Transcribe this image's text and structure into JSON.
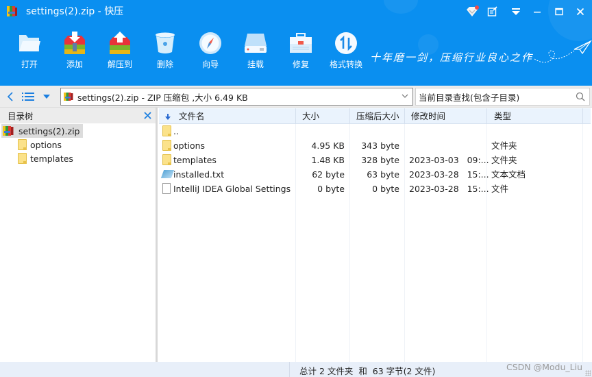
{
  "window": {
    "title": "settings(2).zip - 快压",
    "controls": [
      "vip-diamond-icon",
      "feedback-icon",
      "menu-dropdown-icon",
      "minimize-icon",
      "maximize-icon",
      "close-icon"
    ]
  },
  "toolbar": {
    "items": [
      {
        "label": "打开",
        "icon": "open-folder-icon"
      },
      {
        "label": "添加",
        "icon": "add-archive-icon"
      },
      {
        "label": "解压到",
        "icon": "extract-to-icon"
      },
      {
        "label": "删除",
        "icon": "recycle-bin-icon"
      },
      {
        "label": "向导",
        "icon": "compass-icon"
      },
      {
        "label": "挂载",
        "icon": "drive-icon"
      },
      {
        "label": "修复",
        "icon": "toolbox-icon"
      },
      {
        "label": "格式转换",
        "icon": "convert-arrows-icon"
      }
    ],
    "slogan": "十年磨一剑，压缩行业良心之作"
  },
  "addressbar": {
    "path": "settings(2).zip - ZIP 压缩包 ,大小 6.49 KB",
    "search_value": "当前目录查找(包含子目录)"
  },
  "tree": {
    "title": "目录树",
    "root": "settings(2).zip",
    "children": [
      "options",
      "templates"
    ]
  },
  "filelist": {
    "columns": [
      "文件名",
      "大小",
      "压缩后大小",
      "修改时间",
      "类型"
    ],
    "rows": [
      {
        "name": "..",
        "size": "",
        "packed": "",
        "modified": "",
        "type": "",
        "icon": "folder"
      },
      {
        "name": "options",
        "size": "4.95 KB",
        "packed": "343 byte",
        "modified": "",
        "type": "文件夹",
        "icon": "folder"
      },
      {
        "name": "templates",
        "size": "1.48 KB",
        "packed": "328 byte",
        "modified": "2023-03-03   09:...",
        "type": "文件夹",
        "icon": "folder"
      },
      {
        "name": "installed.txt",
        "size": "62 byte",
        "packed": "63 byte",
        "modified": "2023-03-28   15:...",
        "type": "文本文档",
        "icon": "text"
      },
      {
        "name": "IntelliJ IDEA Global Settings",
        "size": "0 byte",
        "packed": "0 byte",
        "modified": "2023-03-28   15:...",
        "type": "文件",
        "icon": "file"
      }
    ]
  },
  "statusbar": {
    "summary": "总计 2 文件夹  和  63 字节(2 文件)",
    "watermark": "CSDN @Modu_Liu"
  },
  "colors": {
    "header_blue": "#0a8ff0",
    "list_header": "#eaf3fd",
    "statusbar": "#e8eff9"
  }
}
